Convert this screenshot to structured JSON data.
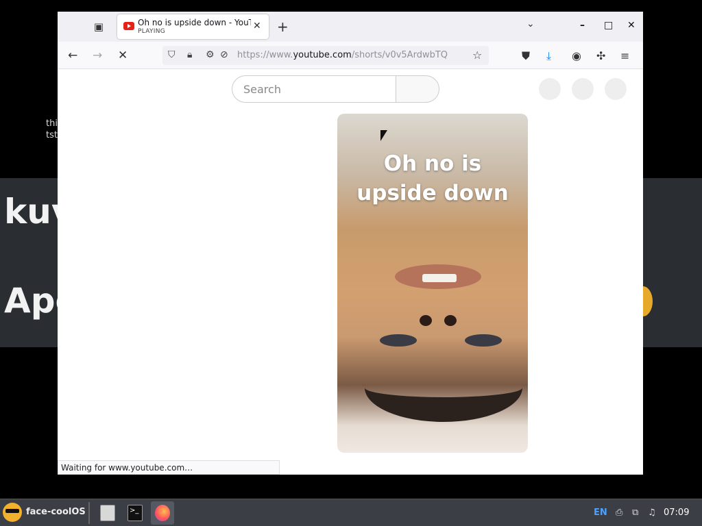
{
  "background": {
    "small_lines": [
      "thi",
      "tst"
    ],
    "big_lines": [
      "kuv",
      "Apo"
    ]
  },
  "tab": {
    "title": "Oh no is upside down - YouTube",
    "status": "PLAYING",
    "close_glyph": "✕"
  },
  "toolbar": {
    "new_tab_glyph": "+",
    "list_tabs_glyph": "⌄",
    "minimize": "–",
    "maximize": "□",
    "close": "✕"
  },
  "nav": {
    "back": "←",
    "forward": "→",
    "stop": "✕",
    "url_prefix": "https://www.",
    "url_domain": "youtube.com",
    "url_path": "/shorts/v0v5ArdwbTQ"
  },
  "page": {
    "search_placeholder": "Search",
    "video_caption_line1": "Oh no is",
    "video_caption_line2": "upside down"
  },
  "status_bar": "Waiting for www.youtube.com…",
  "taskbar": {
    "os_name": "face-coolOS",
    "lang": "EN",
    "clock": "07:09"
  },
  "icons": [
    "tab-overview-icon",
    "shield-icon",
    "lock-icon",
    "permissions-icon",
    "autoplay-blocked-icon",
    "bookmark-star-icon",
    "pocket-icon",
    "downloads-icon",
    "account-icon",
    "extensions-icon",
    "menu-icon",
    "printer-icon",
    "network-icon",
    "audio-icon"
  ],
  "colors": {
    "youtube_red": "#e62117",
    "download_blue": "#0a84ff",
    "taskbar": "#3b3f45"
  }
}
